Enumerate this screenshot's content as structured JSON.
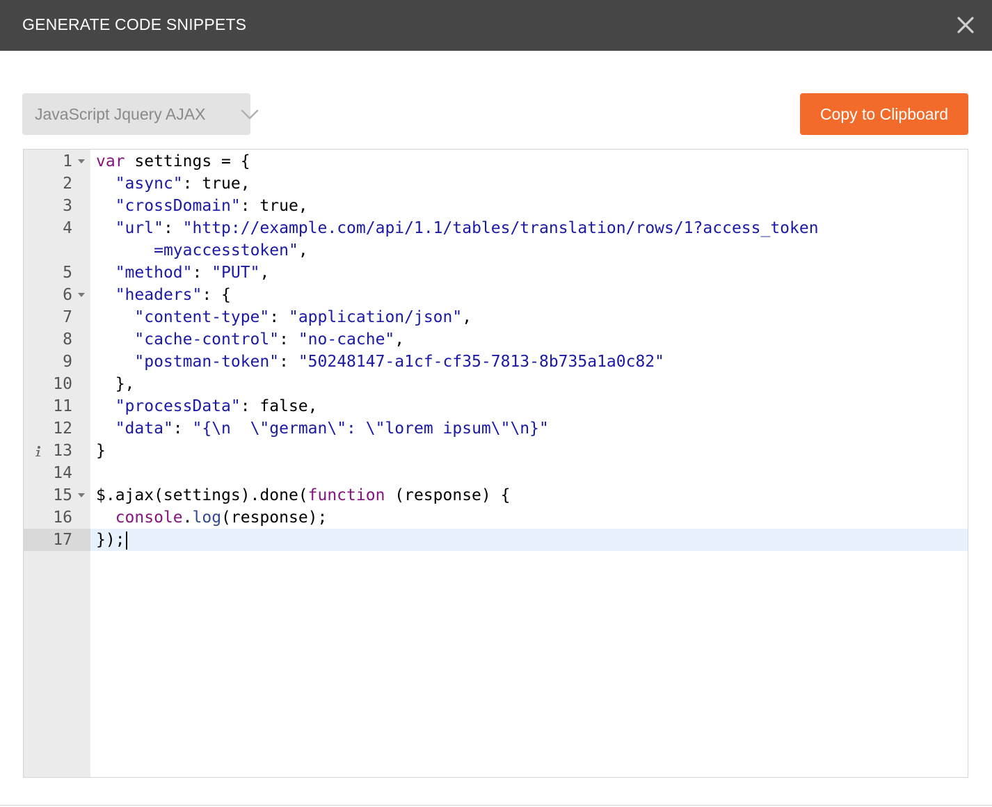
{
  "header": {
    "title": "GENERATE CODE SNIPPETS",
    "close_icon": "close-icon"
  },
  "toolbar": {
    "language_selected": "JavaScript Jquery AJAX",
    "language_chevron_icon": "chevron-down-icon",
    "copy_label": "Copy to Clipboard"
  },
  "colors": {
    "header_bg": "#464646",
    "accent": "#f26b2a",
    "keyword": "#881280",
    "string": "#1a1aa6",
    "active_line": "#e8f2fe"
  },
  "editor": {
    "active_line": "17",
    "lines": [
      {
        "number": "1",
        "foldable": true,
        "info": false,
        "tokens": [
          [
            "kw",
            "var"
          ],
          [
            "plain",
            " settings = {"
          ]
        ]
      },
      {
        "number": "2",
        "foldable": false,
        "info": false,
        "tokens": [
          [
            "plain",
            "  "
          ],
          [
            "str",
            "\"async\""
          ],
          [
            "plain",
            ": true,"
          ]
        ]
      },
      {
        "number": "3",
        "foldable": false,
        "info": false,
        "tokens": [
          [
            "plain",
            "  "
          ],
          [
            "str",
            "\"crossDomain\""
          ],
          [
            "plain",
            ": true,"
          ]
        ]
      },
      {
        "number": "4",
        "foldable": false,
        "info": false,
        "tokens": [
          [
            "plain",
            "  "
          ],
          [
            "str",
            "\"url\""
          ],
          [
            "plain",
            ": "
          ],
          [
            "str",
            "\"http://example.com/api/1.1/tables/translation/rows/1?access_token"
          ]
        ]
      },
      {
        "number": "",
        "foldable": false,
        "info": false,
        "tokens": [
          [
            "plain",
            "      "
          ],
          [
            "str",
            "=myaccesstoken\""
          ],
          [
            "plain",
            ","
          ]
        ]
      },
      {
        "number": "5",
        "foldable": false,
        "info": false,
        "tokens": [
          [
            "plain",
            "  "
          ],
          [
            "str",
            "\"method\""
          ],
          [
            "plain",
            ": "
          ],
          [
            "str",
            "\"PUT\""
          ],
          [
            "plain",
            ","
          ]
        ]
      },
      {
        "number": "6",
        "foldable": true,
        "info": false,
        "tokens": [
          [
            "plain",
            "  "
          ],
          [
            "str",
            "\"headers\""
          ],
          [
            "plain",
            ": {"
          ]
        ]
      },
      {
        "number": "7",
        "foldable": false,
        "info": false,
        "tokens": [
          [
            "plain",
            "    "
          ],
          [
            "str",
            "\"content-type\""
          ],
          [
            "plain",
            ": "
          ],
          [
            "str",
            "\"application/json\""
          ],
          [
            "plain",
            ","
          ]
        ]
      },
      {
        "number": "8",
        "foldable": false,
        "info": false,
        "tokens": [
          [
            "plain",
            "    "
          ],
          [
            "str",
            "\"cache-control\""
          ],
          [
            "plain",
            ": "
          ],
          [
            "str",
            "\"no-cache\""
          ],
          [
            "plain",
            ","
          ]
        ]
      },
      {
        "number": "9",
        "foldable": false,
        "info": false,
        "tokens": [
          [
            "plain",
            "    "
          ],
          [
            "str",
            "\"postman-token\""
          ],
          [
            "plain",
            ": "
          ],
          [
            "str",
            "\"50248147-a1cf-cf35-7813-8b735a1a0c82\""
          ]
        ]
      },
      {
        "number": "10",
        "foldable": false,
        "info": false,
        "tokens": [
          [
            "plain",
            "  },"
          ]
        ]
      },
      {
        "number": "11",
        "foldable": false,
        "info": false,
        "tokens": [
          [
            "plain",
            "  "
          ],
          [
            "str",
            "\"processData\""
          ],
          [
            "plain",
            ": false,"
          ]
        ]
      },
      {
        "number": "12",
        "foldable": false,
        "info": false,
        "tokens": [
          [
            "plain",
            "  "
          ],
          [
            "str",
            "\"data\""
          ],
          [
            "plain",
            ": "
          ],
          [
            "str",
            "\"{\\n  \\\"german\\\": \\\"lorem ipsum\\\"\\n}\""
          ]
        ]
      },
      {
        "number": "13",
        "foldable": false,
        "info": true,
        "tokens": [
          [
            "plain",
            "}"
          ]
        ]
      },
      {
        "number": "14",
        "foldable": false,
        "info": false,
        "tokens": []
      },
      {
        "number": "15",
        "foldable": true,
        "info": false,
        "tokens": [
          [
            "plain",
            "$.ajax(settings).done("
          ],
          [
            "fn",
            "function"
          ],
          [
            "plain",
            " (response) {"
          ]
        ]
      },
      {
        "number": "16",
        "foldable": false,
        "info": false,
        "tokens": [
          [
            "plain",
            "  "
          ],
          [
            "fn",
            "console"
          ],
          [
            "plain",
            "."
          ],
          [
            "log",
            "log"
          ],
          [
            "plain",
            "(response);"
          ]
        ]
      },
      {
        "number": "17",
        "foldable": false,
        "info": false,
        "tokens": [
          [
            "plain",
            "});"
          ]
        ]
      }
    ]
  }
}
